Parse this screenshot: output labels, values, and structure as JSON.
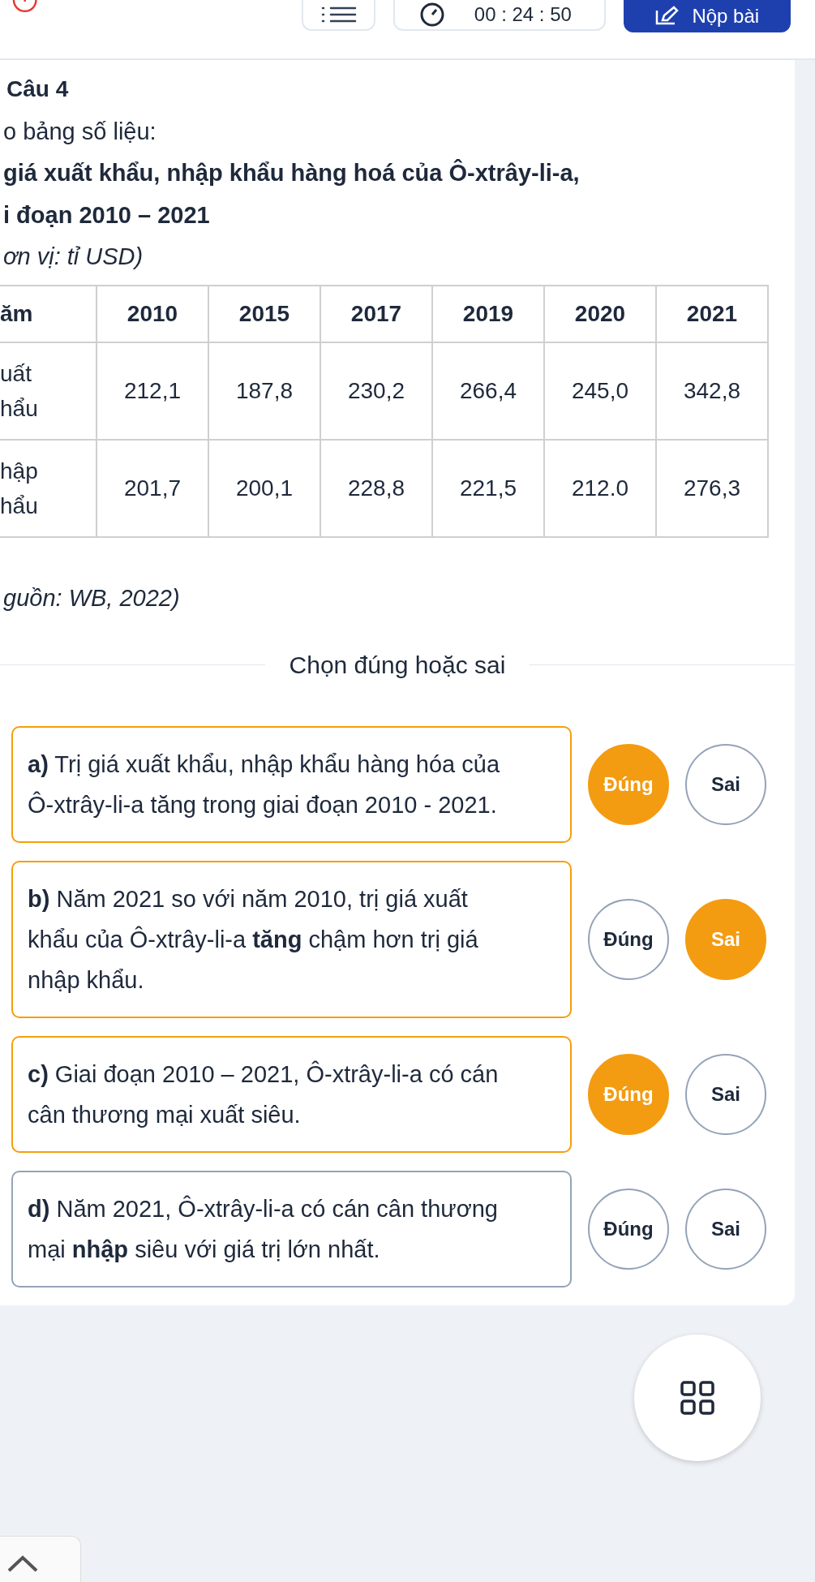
{
  "header": {
    "timer": "00 : 24 : 50",
    "submit": "Nộp bài"
  },
  "question": {
    "title": "Câu 4",
    "intro": "o bảng số liệu:",
    "caption_lines": [
      "giá xuất khẩu, nhập khẩu hàng hoá của Ô-xtrây-li-a,",
      "i đoạn 2010 – 2021"
    ],
    "unit": "ơn vị: tỉ USD)",
    "table": {
      "columns": [
        "ăm",
        "2010",
        "2015",
        "2017",
        "2019",
        "2020",
        "2021"
      ],
      "rows": [
        {
          "cells": [
            "uất\nhẩu",
            "212,1",
            "187,8",
            "230,2",
            "266,4",
            "245,0",
            "342,8"
          ]
        },
        {
          "cells": [
            "hập\nhẩu",
            "201,7",
            "200,1",
            "228,8",
            "221,5",
            "212.0",
            "276,3"
          ]
        }
      ]
    },
    "source": "guồn: WB, 2022)"
  },
  "section_title": "Chọn đúng hoặc sai",
  "statements": [
    {
      "text": "**a)** Trị giá xuất khẩu, nhập khẩu hàng hóa của Ô-xtrây-li-a tăng trong giai đoạn 2010 - 2021.",
      "options": [
        {
          "text": "Đúng",
          "selected": true
        },
        {
          "text": "Sai",
          "selected": false
        }
      ]
    },
    {
      "text": "**b)** Năm 2021 so với năm 2010, trị giá xuất khẩu của Ô-xtrây-li-a **tăng** chậm hơn trị giá nhập khẩu.",
      "options": [
        {
          "text": "Đúng",
          "selected": false
        },
        {
          "text": "Sai",
          "selected": true
        }
      ]
    },
    {
      "text": "**c)** Giai đoạn 2010 – 2021, Ô-xtrây-li-a có cán cân thương mại xuất siêu.",
      "options": [
        {
          "text": "Đúng",
          "selected": true
        },
        {
          "text": "Sai",
          "selected": false
        }
      ]
    },
    {
      "text": "**d)** Năm 2021, Ô-xtrây-li-a có cán cân thương mại **nhập** siêu với giá trị lớn nhất.",
      "options": [
        {
          "text": "Đúng",
          "selected": false
        },
        {
          "text": "Sai",
          "selected": false
        }
      ]
    }
  ]
}
